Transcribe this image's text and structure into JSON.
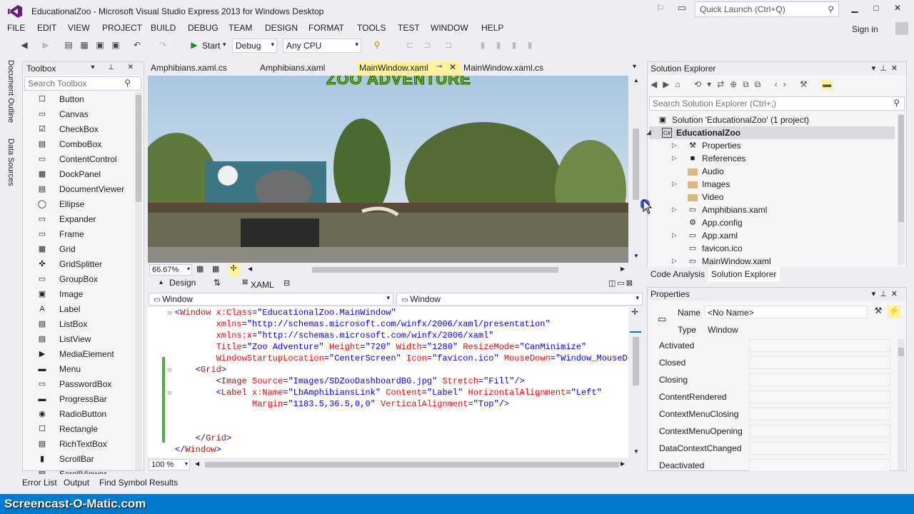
{
  "app": {
    "title": "EducationalZoo - Microsoft Visual Studio Express 2013 for Windows Desktop",
    "quick_launch_placeholder": "Quick Launch (Ctrl+Q)",
    "sign_in": "Sign in"
  },
  "menu": [
    "FILE",
    "EDIT",
    "VIEW",
    "PROJECT",
    "BUILD",
    "DEBUG",
    "TEAM",
    "DESIGN",
    "FORMAT",
    "TOOLS",
    "TEST",
    "WINDOW",
    "HELP"
  ],
  "toolbar": {
    "start_label": "Start",
    "config": "Debug",
    "platform": "Any CPU"
  },
  "left_strip": [
    "Document Outline",
    "Data Sources"
  ],
  "toolbox": {
    "title": "Toolbox",
    "search_placeholder": "Search Toolbox",
    "items": [
      "Button",
      "Canvas",
      "CheckBox",
      "ComboBox",
      "ContentControl",
      "DockPanel",
      "DocumentViewer",
      "Ellipse",
      "Expander",
      "Frame",
      "Grid",
      "GridSplitter",
      "GroupBox",
      "Image",
      "Label",
      "ListBox",
      "ListView",
      "MediaElement",
      "Menu",
      "PasswordBox",
      "ProgressBar",
      "RadioButton",
      "Rectangle",
      "RichTextBox",
      "ScrollBar",
      "ScrollViewer"
    ]
  },
  "doc_tabs": [
    "Amphibians.xaml.cs",
    "Amphibians.xaml",
    "MainWindow.xaml",
    "MainWindow.xaml.cs"
  ],
  "designer": {
    "banner_text": "ZOO ADVENTURE",
    "zoom": "66.67%",
    "zoom_code": "100 %"
  },
  "split": {
    "design_label": "Design",
    "xaml_label": "XAML"
  },
  "nav": {
    "left": "Window",
    "right": "Window"
  },
  "xaml_lines": [
    {
      "indent": 0,
      "parts": [
        [
          "br",
          "<"
        ],
        [
          "tag",
          "Window"
        ],
        [
          "at",
          " x:Class"
        ],
        [
          "br",
          "="
        ],
        [
          "vl",
          "\"EducationalZoo.MainWindow\""
        ]
      ]
    },
    {
      "indent": 8,
      "parts": [
        [
          "at",
          "xmlns"
        ],
        [
          "br",
          "="
        ],
        [
          "vl",
          "\"http://schemas.microsoft.com/winfx/2006/xaml/presentation\""
        ]
      ]
    },
    {
      "indent": 8,
      "parts": [
        [
          "at",
          "xmlns:x"
        ],
        [
          "br",
          "="
        ],
        [
          "vl",
          "\"http://schemas.microsoft.com/winfx/2006/xaml\""
        ]
      ]
    },
    {
      "indent": 8,
      "parts": [
        [
          "at",
          "Title"
        ],
        [
          "br",
          "="
        ],
        [
          "vl",
          "\"Zoo Adventure\""
        ],
        [
          "at",
          " Height"
        ],
        [
          "br",
          "="
        ],
        [
          "vl",
          "\"720\""
        ],
        [
          "at",
          " Width"
        ],
        [
          "br",
          "="
        ],
        [
          "vl",
          "\"1280\""
        ],
        [
          "at",
          " ResizeMode"
        ],
        [
          "br",
          "="
        ],
        [
          "vl",
          "\"CanMinimize\""
        ]
      ]
    },
    {
      "indent": 8,
      "parts": [
        [
          "at",
          "WindowStartupLocation"
        ],
        [
          "br",
          "="
        ],
        [
          "vl",
          "\"CenterScreen\""
        ],
        [
          "at",
          " Icon"
        ],
        [
          "br",
          "="
        ],
        [
          "vl",
          "\"favicon.ico\""
        ],
        [
          "at",
          " MouseDown"
        ],
        [
          "br",
          "="
        ],
        [
          "vl",
          "\"Window_MouseDown\""
        ]
      ]
    },
    {
      "indent": 4,
      "parts": [
        [
          "br",
          "<"
        ],
        [
          "tag",
          "Grid"
        ],
        [
          "br",
          ">"
        ]
      ]
    },
    {
      "indent": 8,
      "parts": [
        [
          "br",
          "<"
        ],
        [
          "tag",
          "Image"
        ],
        [
          "at",
          " Source"
        ],
        [
          "br",
          "="
        ],
        [
          "vl",
          "\"Images/SDZooDashboardBG.jpg\""
        ],
        [
          "at",
          " Stretch"
        ],
        [
          "br",
          "="
        ],
        [
          "vl",
          "\"Fill\""
        ],
        [
          "br",
          "/>"
        ]
      ]
    },
    {
      "indent": 8,
      "parts": [
        [
          "br",
          "<"
        ],
        [
          "tag",
          "Label"
        ],
        [
          "at",
          " x:Name"
        ],
        [
          "br",
          "="
        ],
        [
          "vl",
          "\"LbAmphibiansLink\""
        ],
        [
          "at",
          " Content"
        ],
        [
          "br",
          "="
        ],
        [
          "vl",
          "\"Label\""
        ],
        [
          "at",
          " HorizontalAlignment"
        ],
        [
          "br",
          "="
        ],
        [
          "vl",
          "\"Left\""
        ]
      ]
    },
    {
      "indent": 15,
      "parts": [
        [
          "at",
          "Margin"
        ],
        [
          "br",
          "="
        ],
        [
          "vl",
          "\"1183.5,36.5,0,0\""
        ],
        [
          "at",
          " VerticalAlignment"
        ],
        [
          "br",
          "="
        ],
        [
          "vl",
          "\"Top\""
        ],
        [
          "br",
          "/>"
        ]
      ]
    },
    {
      "indent": 0,
      "parts": []
    },
    {
      "indent": 0,
      "parts": []
    },
    {
      "indent": 4,
      "parts": [
        [
          "br",
          "</"
        ],
        [
          "tag",
          "Grid"
        ],
        [
          "br",
          ">"
        ]
      ]
    },
    {
      "indent": 0,
      "parts": [
        [
          "br",
          "</"
        ],
        [
          "tag",
          "Window"
        ],
        [
          "br",
          ">"
        ]
      ]
    }
  ],
  "solution_explorer": {
    "title": "Solution Explorer",
    "search_placeholder": "Search Solution Explorer (Ctrl+;)",
    "nodes": [
      {
        "label": "Solution 'EducationalZoo' (1 project)",
        "level": 0,
        "arrow": "",
        "icon": "solution"
      },
      {
        "label": "EducationalZoo",
        "level": 1,
        "arrow": "expanded",
        "icon": "csproj"
      },
      {
        "label": "Properties",
        "level": 2,
        "arrow": "collapsed",
        "icon": "wrench"
      },
      {
        "label": "References",
        "level": 2,
        "arrow": "collapsed",
        "icon": "refs"
      },
      {
        "label": "Audio",
        "level": 2,
        "arrow": "",
        "icon": "folder"
      },
      {
        "label": "Images",
        "level": 2,
        "arrow": "collapsed",
        "icon": "folder"
      },
      {
        "label": "Video",
        "level": 2,
        "arrow": "",
        "icon": "folder"
      },
      {
        "label": "Amphibians.xaml",
        "level": 2,
        "arrow": "collapsed",
        "icon": "xaml"
      },
      {
        "label": "App.config",
        "level": 2,
        "arrow": "",
        "icon": "config"
      },
      {
        "label": "App.xaml",
        "level": 2,
        "arrow": "collapsed",
        "icon": "xaml"
      },
      {
        "label": "favicon.ico",
        "level": 2,
        "arrow": "",
        "icon": "ico"
      },
      {
        "label": "MainWindow.xaml",
        "level": 2,
        "arrow": "collapsed",
        "icon": "xaml"
      }
    ],
    "bottom_tabs": [
      "Code Analysis",
      "Solution Explorer"
    ]
  },
  "properties": {
    "title": "Properties",
    "name_label": "Name",
    "name_value": "<No Name>",
    "type_label": "Type",
    "type_value": "Window",
    "events": [
      "Activated",
      "Closed",
      "Closing",
      "ContentRendered",
      "ContextMenuClosing",
      "ContextMenuOpening",
      "DataContextChanged",
      "Deactivated"
    ]
  },
  "bottom_tabs": [
    "Error List",
    "Output",
    "Find Symbol Results"
  ],
  "watermark": "Screencast-O-Matic.com",
  "colors": {
    "accent": "#007acc",
    "active_tab": "#fff29d",
    "selected_tree": "#cce8ff"
  }
}
